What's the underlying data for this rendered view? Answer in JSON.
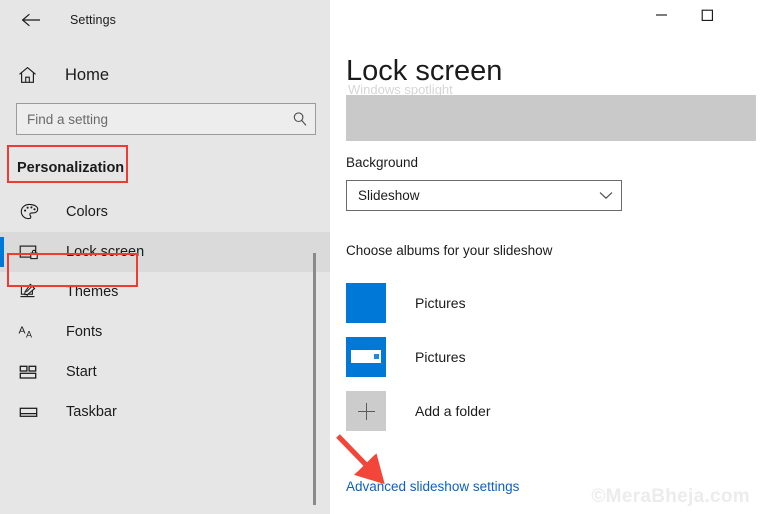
{
  "window": {
    "app_title": "Settings",
    "back_icon": "back-arrow-icon",
    "minimize_label": "—",
    "maximize_label": "□"
  },
  "sidebar": {
    "home_label": "Home",
    "home_icon": "home-icon",
    "search": {
      "placeholder": "Find a setting",
      "value": "",
      "icon": "search-icon"
    },
    "section_heading": "Personalization",
    "items": [
      {
        "label": "Colors",
        "icon": "palette-icon",
        "selected": false
      },
      {
        "label": "Lock screen",
        "icon": "lock-screen-icon",
        "selected": true
      },
      {
        "label": "Themes",
        "icon": "themes-brush-icon",
        "selected": false
      },
      {
        "label": "Fonts",
        "icon": "fonts-aa-icon",
        "selected": false
      },
      {
        "label": "Start",
        "icon": "start-tiles-icon",
        "selected": false
      },
      {
        "label": "Taskbar",
        "icon": "taskbar-icon",
        "selected": false
      }
    ]
  },
  "main": {
    "page_title": "Lock screen",
    "ghost_text": "Windows spotlight",
    "background": {
      "label": "Background",
      "selected_value": "Slideshow",
      "chevron_icon": "chevron-down-icon"
    },
    "albums": {
      "label": "Choose albums for your slideshow",
      "items": [
        {
          "name": "Pictures",
          "thumb": "folder-thumb-plain"
        },
        {
          "name": "Pictures",
          "thumb": "folder-thumb-card"
        }
      ],
      "add_label": "Add a folder",
      "add_icon": "plus-icon"
    },
    "advanced_link": "Advanced slideshow settings"
  },
  "annotations": {
    "arrow_color": "#f2463a",
    "highlight_color": "#ee3b33",
    "watermark": "©MeraBheja.com"
  },
  "colors": {
    "accent": "#0078d7",
    "sidebar_bg": "#e6e6e6",
    "link": "#0a61c9"
  }
}
